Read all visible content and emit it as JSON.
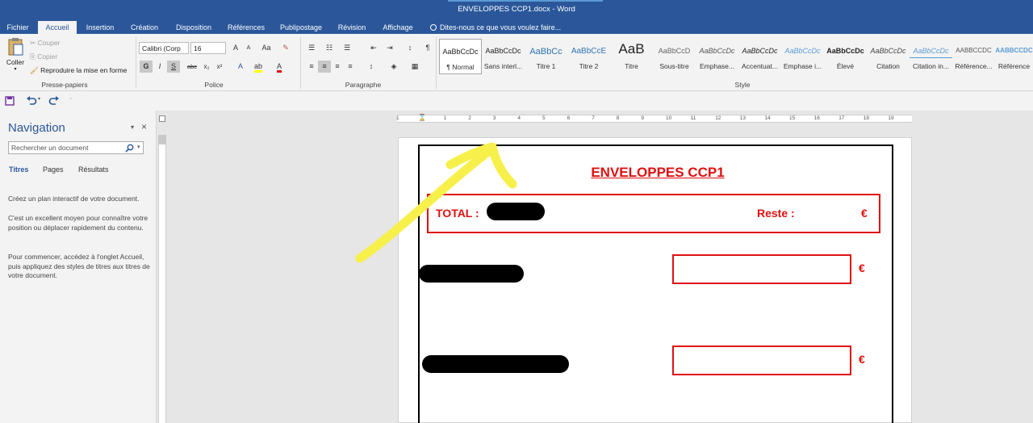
{
  "window": {
    "title": "ENVELOPPES CCP1.docx - Word"
  },
  "tabs": [
    "Fichier",
    "Accueil",
    "Insertion",
    "Création",
    "Disposition",
    "Références",
    "Publipostage",
    "Révision",
    "Affichage"
  ],
  "tell_me": "Dites-nous ce que vous voulez faire...",
  "clipboard": {
    "paste": "Coller",
    "cut": "Couper",
    "copy": "Copier",
    "format_painter": "Reproduire la mise en forme",
    "label": "Presse-papiers"
  },
  "font": {
    "name": "Calibri (Corp",
    "size": "16",
    "grow": "A",
    "shrink": "A",
    "case": "Aa",
    "bold": "G",
    "italic": "I",
    "underline": "S",
    "strike": "abc",
    "subscript": "x₂",
    "superscript": "x²",
    "label": "Police"
  },
  "paragraph": {
    "label": "Paragraphe"
  },
  "styles": {
    "label": "Style",
    "items": [
      {
        "preview": "AaBbCcDc",
        "name": "¶ Normal"
      },
      {
        "preview": "AaBbCcDc",
        "name": "Sans interl..."
      },
      {
        "preview": "AaBbCc",
        "name": "Titre 1"
      },
      {
        "preview": "AaBbCcE",
        "name": "Titre 2"
      },
      {
        "preview": "AaB",
        "name": "Titre"
      },
      {
        "preview": "AaBbCcD",
        "name": "Sous-titre"
      },
      {
        "preview": "AaBbCcDc",
        "name": "Emphase..."
      },
      {
        "preview": "AaBbCcDc",
        "name": "Accentuat..."
      },
      {
        "preview": "AaBbCcDc",
        "name": "Emphase i..."
      },
      {
        "preview": "AaBbCcDc",
        "name": "Élevé"
      },
      {
        "preview": "AaBbCcDc",
        "name": "Citation"
      },
      {
        "preview": "AaBbCcDc",
        "name": "Citation in..."
      },
      {
        "preview": "AABBCCDC",
        "name": "Référence..."
      },
      {
        "preview": "AABBCCDC",
        "name": "Référence"
      }
    ]
  },
  "navigation": {
    "title": "Navigation",
    "search_placeholder": "Rechercher un document",
    "tabs": [
      "Titres",
      "Pages",
      "Résultats"
    ],
    "paragraphs": [
      "Créez un plan interactif de votre document.",
      "C'est un excellent moyen pour connaître votre position ou déplacer rapidement du contenu.",
      "Pour commencer, accédez à l'onglet Accueil, puis appliquez des styles de titres aux titres de votre document."
    ]
  },
  "ruler": {
    "numbers": [
      "1",
      "1",
      "2",
      "3",
      "4",
      "5",
      "6",
      "7",
      "8",
      "9",
      "10",
      "11",
      "12",
      "13",
      "14",
      "15",
      "16",
      "17",
      "18",
      "19"
    ]
  },
  "document": {
    "title": "ENVELOPPES CCP1",
    "total_label": "TOTAL :",
    "total_currency": "€",
    "reste_label": "Reste :",
    "reste_currency": "€",
    "row_currency": "€"
  },
  "colors": {
    "word_blue": "#2b579a",
    "document_red": "#e01010",
    "annotation_yellow": "#f7f04a"
  }
}
